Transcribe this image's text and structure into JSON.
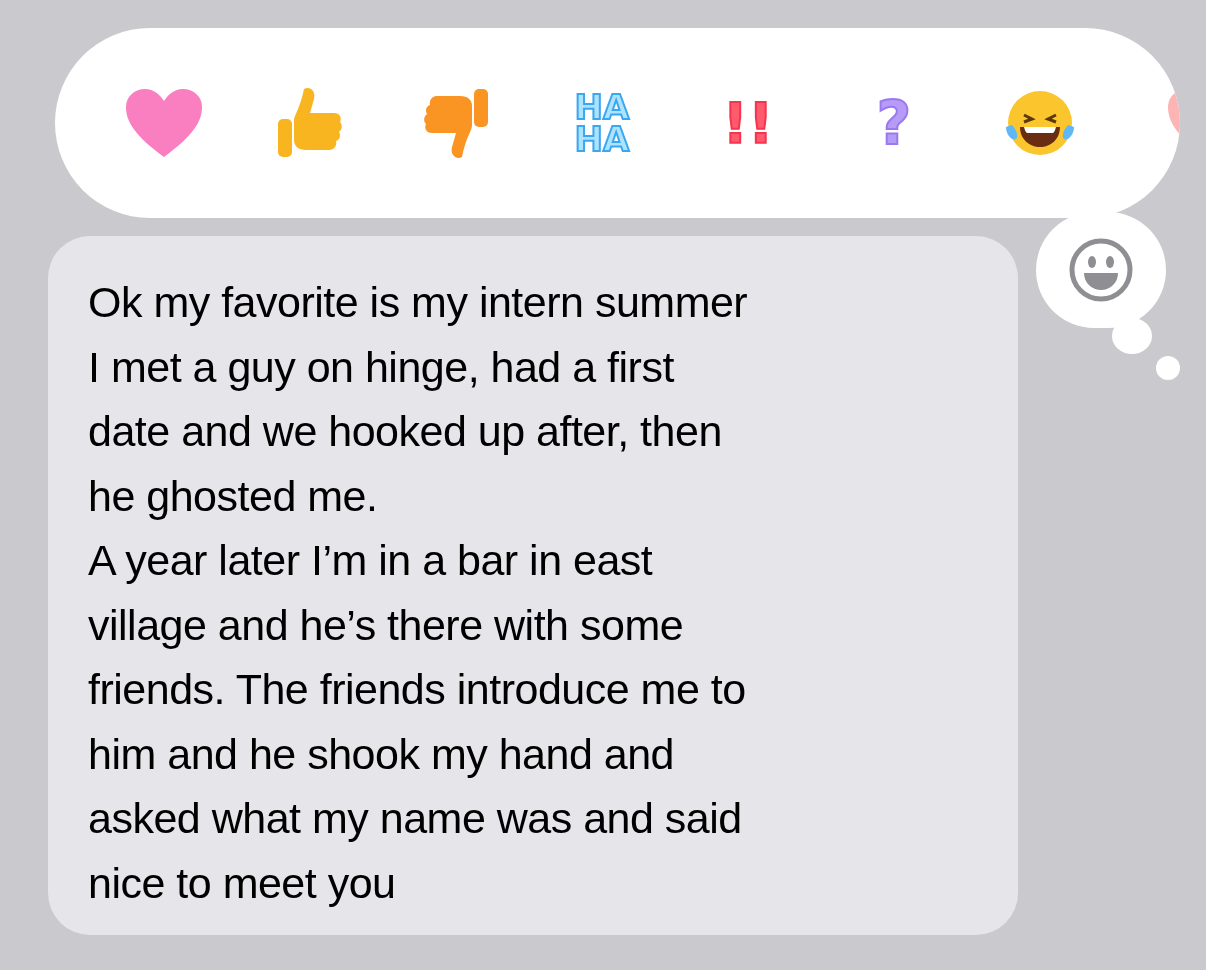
{
  "reactions": [
    {
      "kind": "heart"
    },
    {
      "kind": "thumbs-up"
    },
    {
      "kind": "thumbs-down"
    },
    {
      "kind": "haha",
      "text": "HA HA"
    },
    {
      "kind": "exclaim",
      "text": "!!"
    },
    {
      "kind": "question",
      "text": "?"
    },
    {
      "kind": "laughing"
    },
    {
      "kind": "heart-partial"
    }
  ],
  "message": {
    "lines": [
      "Ok my favorite is my intern summer",
      "I met a guy on hinge, had a first",
      "date and we hooked up after, then",
      "he ghosted me.",
      "A year later I’m in a bar in east",
      "village and he’s there with some",
      "friends. The friends introduce me to",
      "him and he shook my hand and",
      "asked what my name was and said",
      "nice to meet you"
    ]
  }
}
